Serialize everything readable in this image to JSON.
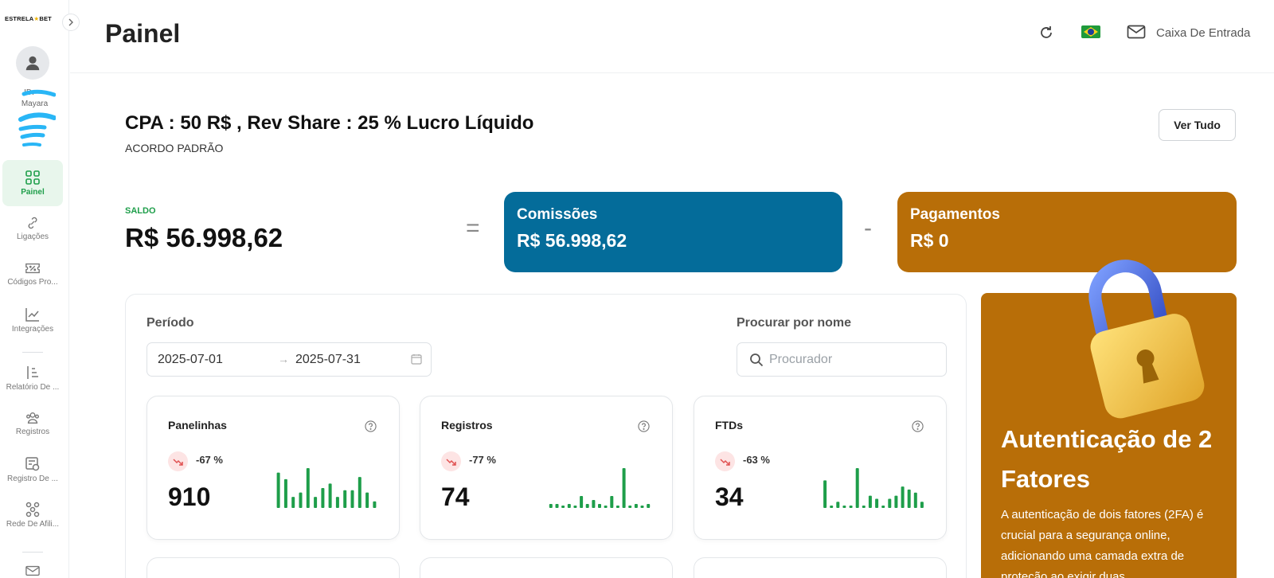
{
  "brand": {
    "logo_left": "ESTRELA",
    "logo_star": "★",
    "logo_right": "BET"
  },
  "user": {
    "id_label": "ID:",
    "name": "Mayara"
  },
  "sidebar": {
    "items": [
      {
        "label": "Painel",
        "icon": "grid-icon",
        "active": true
      },
      {
        "label": "Ligações",
        "icon": "link-icon"
      },
      {
        "label": "Códigos Pro...",
        "icon": "coupon-icon"
      },
      {
        "label": "Integrações",
        "icon": "chart-line-icon"
      },
      {
        "label": "Relatório De ...",
        "icon": "report-icon"
      },
      {
        "label": "Registros",
        "icon": "users-icon"
      },
      {
        "label": "Registro De ...",
        "icon": "register-log-icon"
      },
      {
        "label": "Rede De Afili...",
        "icon": "network-icon"
      }
    ]
  },
  "header": {
    "title": "Painel",
    "inbox_label": "Caixa De Entrada"
  },
  "deal": {
    "title": "CPA : 50 R$ , Rev Share : 25 % Lucro Líquido",
    "subtitle": "ACORDO PADRÃO",
    "view_all": "Ver Tudo"
  },
  "balance": {
    "label": "SALDO",
    "value": "R$ 56.998,62",
    "equals": "=",
    "minus": "-",
    "commissions": {
      "label": "Comissões",
      "value": "R$ 56.998,62",
      "color": "#046c9a"
    },
    "payments": {
      "label": "Pagamentos",
      "value": "R$ 0",
      "color": "#b86e08"
    }
  },
  "filters": {
    "period_label": "Período",
    "date_from": "2025-07-01",
    "date_arrow": "→",
    "date_to": "2025-07-31",
    "search_label": "Procurar por nome",
    "search_placeholder": "Procurador"
  },
  "stats": [
    {
      "title": "Panelinhas",
      "change": "-67 %",
      "value": "910",
      "spark": [
        16,
        13,
        5,
        7,
        18,
        5,
        9,
        11,
        5,
        8,
        8,
        14,
        7,
        3
      ]
    },
    {
      "title": "Registros",
      "change": "-77 %",
      "value": "74",
      "spark": [
        1,
        1,
        0,
        1,
        0,
        3,
        1,
        2,
        1,
        0,
        3,
        0,
        10,
        0,
        1,
        0,
        1
      ]
    },
    {
      "title": "FTDs",
      "change": "-63 %",
      "value": "34",
      "spark": [
        9,
        0,
        2,
        0,
        0,
        13,
        0,
        4,
        3,
        0,
        3,
        4,
        7,
        6,
        5,
        2
      ]
    }
  ],
  "promo": {
    "title": "Autenticação de 2 Fatores",
    "text": "A autenticação de dois fatores (2FA) é crucial para a segurança online, adicionando uma camada extra de proteção ao exigir duas",
    "color": "#b86e08"
  },
  "colors": {
    "accent_green": "#1e9e4a",
    "trend_down_bg": "#fde4e4",
    "trend_down_fg": "#e05050"
  }
}
